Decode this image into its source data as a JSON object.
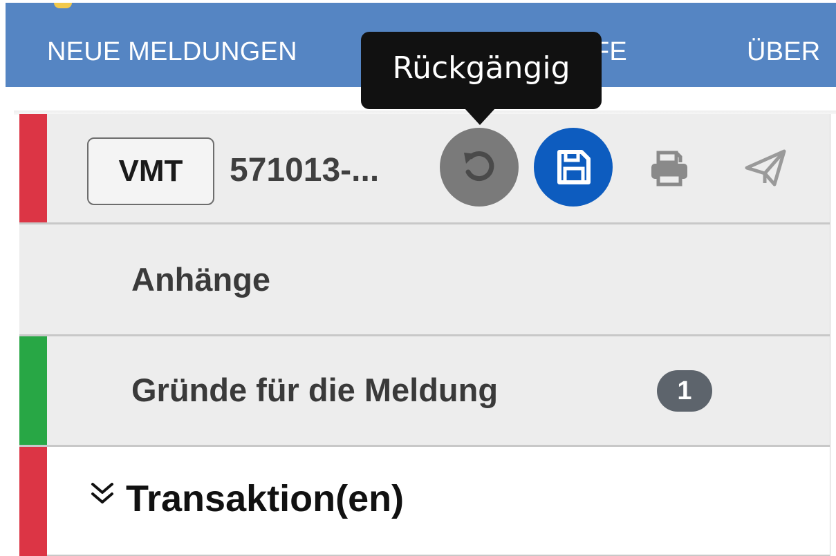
{
  "nav": {
    "items": [
      {
        "label": "NEUE MELDUNGEN",
        "icon": "caret-down-icon"
      },
      {
        "label": "ENTWÜRFE"
      },
      {
        "label": "ÜBER"
      }
    ]
  },
  "tooltip": {
    "text": "Rückgängig"
  },
  "header": {
    "type_badge": "VMT",
    "reference": "571013-...",
    "actions": [
      {
        "name": "undo",
        "icon": "undo-icon",
        "color": "#7a7a7a"
      },
      {
        "name": "save",
        "icon": "floppy-disk-icon",
        "color": "#0d5cbf"
      },
      {
        "name": "print",
        "icon": "printer-icon"
      },
      {
        "name": "send",
        "icon": "paper-plane-icon"
      }
    ]
  },
  "sections": {
    "attachments": {
      "title": "Anhänge"
    },
    "reasons": {
      "title": "Gründe für die Meldung",
      "count": "1",
      "status_color": "#28a745"
    },
    "transactions": {
      "title": "Transaktion(en)",
      "icon": "chevrons-down-icon",
      "status_color": "#dc3545"
    }
  },
  "colors": {
    "nav_bg": "#5585c3",
    "error": "#dc3545",
    "ok": "#28a745",
    "primary": "#0d5cbf"
  }
}
